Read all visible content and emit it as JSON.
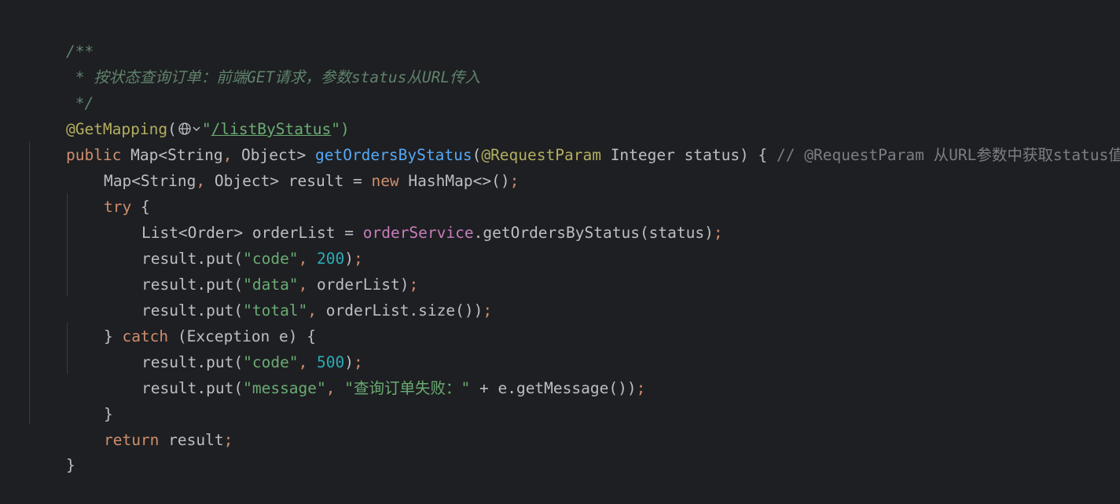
{
  "colors": {
    "background": "#1e1f22",
    "comment": "#5f826b",
    "line_comment": "#7a7e85",
    "annotation": "#b3ae60",
    "keyword": "#cf8e6d",
    "method_decl": "#56a8f5",
    "string": "#6aab73",
    "number": "#2aacb8",
    "field": "#c77dbb",
    "text": "#bcbec4"
  },
  "icons": {
    "url_inlay": "globe-icon",
    "url_inlay_menu": "chevron-down-icon"
  },
  "code": {
    "l1": {
      "comment": "/**"
    },
    "l2": {
      "comment": " * 按状态查询订单：前端GET请求，参数status从URL传入"
    },
    "l3": {
      "comment": " */"
    },
    "l4": {
      "annotation": "@GetMapping",
      "open": "(",
      "quote_open": "\"",
      "path": "/listByStatus",
      "close": "\")"
    },
    "l5": {
      "public": "public",
      "ret_type": " Map<String",
      "comma": ",",
      "ret_type2": " Object> ",
      "method": "getOrdersByStatus",
      "open": "(",
      "annotation": "@RequestParam",
      "params": " Integer status) { ",
      "line_comment": "// @RequestParam 从URL参数中获取status值"
    },
    "l6": {
      "decl": "Map<String",
      "comma": ",",
      "decl2": " Object> result = ",
      "new_kw": "new",
      "ctor": " HashMap<>()",
      "semi": ";"
    },
    "l7": {
      "try_kw": "try",
      "brace": " {"
    },
    "l8": {
      "decl": "List<Order> orderList = ",
      "field": "orderService",
      "call": ".getOrdersByStatus(status)",
      "semi": ";"
    },
    "l9": {
      "call": "result.put(",
      "key": "\"code\"",
      "comma": ", ",
      "value": "200",
      "close": ")",
      "semi": ";"
    },
    "l10": {
      "call": "result.put(",
      "key": "\"data\"",
      "comma": ", ",
      "value": "orderList)",
      "semi": ";"
    },
    "l11": {
      "call": "result.put(",
      "key": "\"total\"",
      "comma": ", ",
      "value": "orderList.size())",
      "semi": ";"
    },
    "l12": {
      "brace": "} ",
      "catch_kw": "catch",
      "params": " (Exception e) {"
    },
    "l13": {
      "call": "result.put(",
      "key": "\"code\"",
      "comma": ", ",
      "value": "500",
      "close": ")",
      "semi": ";"
    },
    "l14": {
      "call": "result.put(",
      "key": "\"message\"",
      "comma": ", ",
      "value": "\"查询订单失败：\"",
      "rest": " + e.getMessage())",
      "semi": ";"
    },
    "l15": {
      "brace": "}"
    },
    "l16": {
      "return_kw": "return",
      "rest": " result",
      "semi": ";"
    },
    "l17": {
      "brace": "}"
    }
  }
}
